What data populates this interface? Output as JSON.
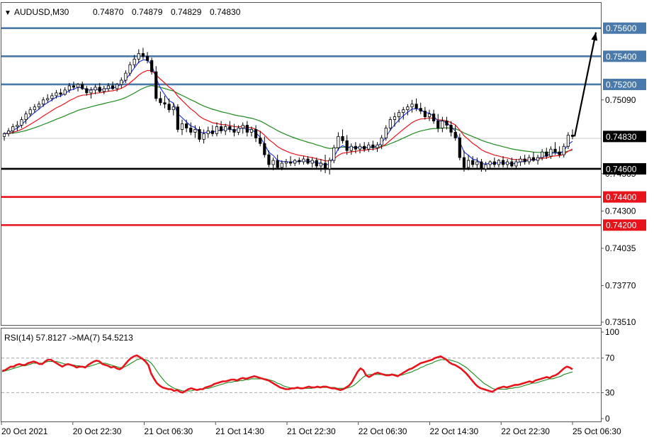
{
  "chart_data": [
    {
      "type": "candlestick",
      "symbol_line": "AUDUSD,M30",
      "ohlc_readout": [
        "0.74870",
        "0.74879",
        "0.74829",
        "0.74830"
      ],
      "ylim": [
        0.7349,
        0.7578
      ],
      "y_ticks": [
        "0.75090",
        "0.74565",
        "0.74300",
        "0.74035",
        "0.73770",
        "0.73510"
      ],
      "current_price": "0.74830",
      "levels": [
        {
          "value": 0.756,
          "label": "0.75600",
          "color": "#4a7aab"
        },
        {
          "value": 0.754,
          "label": "0.75400",
          "color": "#4a7aab"
        },
        {
          "value": 0.752,
          "label": "0.75200",
          "color": "#4a7aab"
        },
        {
          "value": 0.746,
          "label": "0.74600",
          "color": "#000000"
        },
        {
          "value": 0.744,
          "label": "0.74400",
          "color": "#e8141c"
        },
        {
          "value": 0.742,
          "label": "0.74200",
          "color": "#e8141c"
        }
      ],
      "arrow": {
        "from": 0.7483,
        "to": 0.7557
      },
      "ma_colors": {
        "fast": "#2a3bd6",
        "mid": "#e8141c",
        "slow": "#1e8a1e"
      },
      "candles": [
        [
          0.7483,
          0.7486,
          0.748,
          0.7485
        ],
        [
          0.7485,
          0.7489,
          0.7483,
          0.7487
        ],
        [
          0.7487,
          0.7492,
          0.7485,
          0.749
        ],
        [
          0.749,
          0.7494,
          0.7487,
          0.7491
        ],
        [
          0.7491,
          0.7497,
          0.7489,
          0.7495
        ],
        [
          0.7495,
          0.7501,
          0.7492,
          0.7499
        ],
        [
          0.7499,
          0.7504,
          0.7497,
          0.7502
        ],
        [
          0.7502,
          0.7506,
          0.75,
          0.7504
        ],
        [
          0.7504,
          0.7508,
          0.7502,
          0.7506
        ],
        [
          0.7506,
          0.7511,
          0.7504,
          0.7509
        ],
        [
          0.7509,
          0.7513,
          0.7507,
          0.751
        ],
        [
          0.751,
          0.7514,
          0.7508,
          0.7512
        ],
        [
          0.7512,
          0.7516,
          0.751,
          0.7514
        ],
        [
          0.7514,
          0.7517,
          0.7511,
          0.7513
        ],
        [
          0.7513,
          0.7518,
          0.7512,
          0.7516
        ],
        [
          0.7516,
          0.7521,
          0.7514,
          0.7519
        ],
        [
          0.7519,
          0.7522,
          0.7516,
          0.7518
        ],
        [
          0.7518,
          0.7521,
          0.7515,
          0.752
        ],
        [
          0.752,
          0.7522,
          0.7516,
          0.7517
        ],
        [
          0.7517,
          0.7519,
          0.7512,
          0.7514
        ],
        [
          0.7514,
          0.7518,
          0.751,
          0.7516
        ],
        [
          0.7516,
          0.752,
          0.7513,
          0.7518
        ],
        [
          0.7518,
          0.7521,
          0.7514,
          0.7515
        ],
        [
          0.7515,
          0.7519,
          0.7513,
          0.7517
        ],
        [
          0.7517,
          0.7521,
          0.7515,
          0.7519
        ],
        [
          0.7519,
          0.7522,
          0.7516,
          0.7517
        ],
        [
          0.7517,
          0.7521,
          0.7515,
          0.752
        ],
        [
          0.752,
          0.7525,
          0.7517,
          0.7523
        ],
        [
          0.7523,
          0.753,
          0.7521,
          0.7528
        ],
        [
          0.7528,
          0.7536,
          0.7526,
          0.7534
        ],
        [
          0.7534,
          0.7541,
          0.7532,
          0.7538
        ],
        [
          0.7538,
          0.7545,
          0.7535,
          0.7542
        ],
        [
          0.7542,
          0.7546,
          0.7538,
          0.754
        ],
        [
          0.754,
          0.7543,
          0.7535,
          0.7537
        ],
        [
          0.7537,
          0.7539,
          0.7527,
          0.7529
        ],
        [
          0.7529,
          0.7533,
          0.7508,
          0.751
        ],
        [
          0.751,
          0.7515,
          0.7505,
          0.7507
        ],
        [
          0.7507,
          0.7512,
          0.7503,
          0.7506
        ],
        [
          0.7506,
          0.751,
          0.75,
          0.7502
        ],
        [
          0.7502,
          0.7507,
          0.7498,
          0.7504
        ],
        [
          0.7504,
          0.7506,
          0.7486,
          0.7488
        ],
        [
          0.7488,
          0.7495,
          0.7484,
          0.7492
        ],
        [
          0.7492,
          0.7495,
          0.7486,
          0.7489
        ],
        [
          0.7489,
          0.7493,
          0.7484,
          0.7486
        ],
        [
          0.7486,
          0.7491,
          0.7482,
          0.7488
        ],
        [
          0.7488,
          0.749,
          0.7479,
          0.7481
        ],
        [
          0.7481,
          0.7488,
          0.7478,
          0.7485
        ],
        [
          0.7485,
          0.749,
          0.7482,
          0.7487
        ],
        [
          0.7487,
          0.7491,
          0.7483,
          0.7485
        ],
        [
          0.7485,
          0.7493,
          0.7483,
          0.749
        ],
        [
          0.749,
          0.7494,
          0.7485,
          0.7487
        ],
        [
          0.7487,
          0.7492,
          0.7484,
          0.749
        ],
        [
          0.749,
          0.7494,
          0.7486,
          0.7488
        ],
        [
          0.7488,
          0.7492,
          0.7483,
          0.7486
        ],
        [
          0.7486,
          0.7491,
          0.7484,
          0.7489
        ],
        [
          0.7489,
          0.7493,
          0.7485,
          0.7491
        ],
        [
          0.7491,
          0.7494,
          0.7483,
          0.7486
        ],
        [
          0.7486,
          0.749,
          0.7483,
          0.7488
        ],
        [
          0.7488,
          0.7491,
          0.7479,
          0.7482
        ],
        [
          0.7482,
          0.7487,
          0.7476,
          0.7478
        ],
        [
          0.7478,
          0.7483,
          0.7468,
          0.747
        ],
        [
          0.747,
          0.7473,
          0.7461,
          0.7463
        ],
        [
          0.7463,
          0.7468,
          0.7459,
          0.7466
        ],
        [
          0.7466,
          0.747,
          0.746,
          0.7461
        ],
        [
          0.7461,
          0.7466,
          0.7459,
          0.7464
        ],
        [
          0.7464,
          0.7467,
          0.7461,
          0.7465
        ],
        [
          0.7465,
          0.7469,
          0.7462,
          0.7464
        ],
        [
          0.7464,
          0.7467,
          0.7462,
          0.7466
        ],
        [
          0.7466,
          0.7468,
          0.7463,
          0.7465
        ],
        [
          0.7465,
          0.7469,
          0.7463,
          0.7467
        ],
        [
          0.7467,
          0.7469,
          0.7463,
          0.7464
        ],
        [
          0.7464,
          0.7468,
          0.7461,
          0.7466
        ],
        [
          0.7466,
          0.7468,
          0.746,
          0.7462
        ],
        [
          0.7462,
          0.7467,
          0.7458,
          0.7464
        ],
        [
          0.7464,
          0.747,
          0.7457,
          0.746
        ],
        [
          0.746,
          0.7468,
          0.7456,
          0.7466
        ],
        [
          0.7466,
          0.7477,
          0.7464,
          0.7475
        ],
        [
          0.7475,
          0.7486,
          0.7473,
          0.7483
        ],
        [
          0.7483,
          0.7488,
          0.7478,
          0.748
        ],
        [
          0.748,
          0.7484,
          0.747,
          0.7473
        ],
        [
          0.7473,
          0.7478,
          0.747,
          0.7476
        ],
        [
          0.7476,
          0.7479,
          0.7471,
          0.7474
        ],
        [
          0.7474,
          0.7478,
          0.7471,
          0.7476
        ],
        [
          0.7476,
          0.7479,
          0.7472,
          0.7474
        ],
        [
          0.7474,
          0.7479,
          0.7472,
          0.7477
        ],
        [
          0.7477,
          0.748,
          0.7473,
          0.7475
        ],
        [
          0.7475,
          0.7479,
          0.7472,
          0.7477
        ],
        [
          0.7477,
          0.7484,
          0.7474,
          0.7482
        ],
        [
          0.7482,
          0.7491,
          0.748,
          0.7489
        ],
        [
          0.7489,
          0.7497,
          0.7487,
          0.7495
        ],
        [
          0.7495,
          0.75,
          0.749,
          0.7497
        ],
        [
          0.7497,
          0.7502,
          0.7493,
          0.75
        ],
        [
          0.75,
          0.7504,
          0.7495,
          0.7502
        ],
        [
          0.7502,
          0.7506,
          0.7498,
          0.7504
        ],
        [
          0.7504,
          0.7509,
          0.75,
          0.7506
        ],
        [
          0.7506,
          0.751,
          0.7501,
          0.7503
        ],
        [
          0.7503,
          0.7507,
          0.7499,
          0.7501
        ],
        [
          0.7501,
          0.7504,
          0.7495,
          0.7497
        ],
        [
          0.7497,
          0.7502,
          0.7494,
          0.7499
        ],
        [
          0.7499,
          0.7502,
          0.7492,
          0.7494
        ],
        [
          0.7494,
          0.7499,
          0.7486,
          0.7489
        ],
        [
          0.7489,
          0.7497,
          0.7486,
          0.7494
        ],
        [
          0.7494,
          0.7497,
          0.7488,
          0.7491
        ],
        [
          0.7491,
          0.7494,
          0.7483,
          0.7486
        ],
        [
          0.7486,
          0.7491,
          0.748,
          0.7482
        ],
        [
          0.7482,
          0.7485,
          0.7466,
          0.7468
        ],
        [
          0.7468,
          0.7473,
          0.7458,
          0.7461
        ],
        [
          0.7461,
          0.747,
          0.7459,
          0.7466
        ],
        [
          0.7466,
          0.7469,
          0.7461,
          0.7463
        ],
        [
          0.7463,
          0.7468,
          0.746,
          0.7465
        ],
        [
          0.7465,
          0.7467,
          0.7458,
          0.746
        ],
        [
          0.746,
          0.7465,
          0.7458,
          0.7463
        ],
        [
          0.7463,
          0.7466,
          0.746,
          0.7465
        ],
        [
          0.7465,
          0.7468,
          0.7461,
          0.7463
        ],
        [
          0.7463,
          0.7467,
          0.7461,
          0.7466
        ],
        [
          0.7466,
          0.7469,
          0.7461,
          0.7463
        ],
        [
          0.7463,
          0.7467,
          0.746,
          0.7465
        ],
        [
          0.7465,
          0.7468,
          0.7461,
          0.7462
        ],
        [
          0.7462,
          0.7467,
          0.746,
          0.7465
        ],
        [
          0.7465,
          0.7469,
          0.7462,
          0.7467
        ],
        [
          0.7467,
          0.747,
          0.7463,
          0.7465
        ],
        [
          0.7465,
          0.747,
          0.7463,
          0.7468
        ],
        [
          0.7468,
          0.7472,
          0.7465,
          0.7466
        ],
        [
          0.7466,
          0.747,
          0.7463,
          0.7468
        ],
        [
          0.7468,
          0.7474,
          0.7466,
          0.7472
        ],
        [
          0.7472,
          0.7475,
          0.7467,
          0.7469
        ],
        [
          0.7469,
          0.7476,
          0.7467,
          0.7474
        ],
        [
          0.7474,
          0.7479,
          0.747,
          0.7472
        ],
        [
          0.7472,
          0.7476,
          0.7468,
          0.747
        ],
        [
          0.747,
          0.7478,
          0.7468,
          0.7476
        ],
        [
          0.7476,
          0.7486,
          0.7474,
          0.7484
        ],
        [
          0.7484,
          0.7488,
          0.7481,
          0.7483
        ]
      ],
      "rsi": {
        "label": "RSI(14) 57.8127  ->MA(7) 54.5213",
        "ylim": [
          0,
          100
        ],
        "ticks": [
          "100",
          "70",
          "30",
          "0"
        ],
        "levels": [
          70,
          30
        ],
        "values": [
          55,
          56,
          58,
          60,
          60,
          62,
          63,
          62,
          62,
          64,
          65,
          66,
          65,
          63,
          63,
          66,
          68,
          68,
          66,
          64,
          62,
          60,
          62,
          63,
          62,
          61,
          59,
          60,
          60,
          59,
          62,
          64,
          66,
          67,
          66,
          63,
          62,
          61,
          59,
          60,
          58,
          57,
          59,
          63,
          67,
          70,
          72,
          73,
          71,
          69,
          66,
          62,
          52,
          46,
          41,
          38,
          36,
          35,
          34,
          34,
          32,
          33,
          31,
          30,
          32,
          34,
          35,
          34,
          33,
          34,
          34,
          36,
          37,
          38,
          40,
          41,
          42,
          43,
          43,
          44,
          45,
          45,
          44,
          46,
          47,
          46,
          47,
          48,
          49,
          48,
          47,
          46,
          45,
          44,
          42,
          40,
          38,
          36,
          35,
          34,
          34,
          35,
          35,
          36,
          35,
          35,
          36,
          37,
          36,
          36,
          37,
          36,
          37,
          37,
          36,
          35,
          35,
          34,
          33,
          34,
          36,
          38,
          42,
          48,
          54,
          58,
          56,
          50,
          48,
          50,
          52,
          53,
          52,
          51,
          50,
          50,
          51,
          50,
          49,
          51,
          53,
          55,
          57,
          58,
          60,
          62,
          64,
          65,
          66,
          67,
          68,
          70,
          71,
          72,
          70,
          68,
          65,
          63,
          62,
          60,
          58,
          55,
          52,
          48,
          44,
          40,
          37,
          35,
          34,
          33,
          32,
          31,
          33,
          35,
          36,
          37,
          36,
          37,
          38,
          39,
          39,
          40,
          41,
          42,
          43,
          42,
          44,
          45,
          46,
          47,
          48,
          47,
          49,
          50,
          52,
          55,
          58,
          60,
          59,
          57
        ],
        "ma": [
          54,
          55,
          56,
          57,
          58,
          59,
          60,
          61,
          61,
          62,
          63,
          64,
          64,
          64,
          64,
          65,
          66,
          66,
          66,
          66,
          65,
          64,
          63,
          63,
          62,
          62,
          61,
          61,
          60,
          60,
          60,
          61,
          62,
          63,
          64,
          64,
          64,
          63,
          62,
          61,
          60,
          59,
          59,
          60,
          62,
          64,
          66,
          68,
          69,
          69,
          68,
          67,
          64,
          60,
          55,
          50,
          46,
          42,
          39,
          37,
          35,
          34,
          33,
          32,
          32,
          32,
          32,
          33,
          33,
          34,
          34,
          35,
          35,
          36,
          37,
          38,
          39,
          40,
          41,
          42,
          42,
          43,
          43,
          44,
          44,
          45,
          45,
          46,
          46,
          46,
          46,
          46,
          46,
          45,
          44,
          43,
          41,
          40,
          38,
          37,
          36,
          35,
          35,
          35,
          35,
          35,
          35,
          35,
          35,
          36,
          36,
          36,
          36,
          36,
          36,
          36,
          36,
          35,
          35,
          35,
          35,
          36,
          37,
          39,
          42,
          45,
          48,
          50,
          51,
          51,
          51,
          51,
          51,
          51,
          51,
          51,
          51,
          51,
          50,
          50,
          51,
          52,
          53,
          54,
          56,
          57,
          59,
          60,
          62,
          63,
          64,
          66,
          67,
          68,
          68,
          68,
          68,
          67,
          66,
          65,
          63,
          61,
          59,
          56,
          53,
          50,
          47,
          44,
          41,
          39,
          37,
          35,
          34,
          34,
          34,
          34,
          34,
          35,
          35,
          36,
          36,
          37,
          38,
          39,
          40,
          41,
          41,
          42,
          43,
          44,
          45,
          46,
          46,
          47,
          48,
          49,
          51,
          52,
          53,
          54
        ]
      },
      "x_ticks": [
        "20 Oct 2021",
        "20 Oct 22:30",
        "21 Oct 06:30",
        "21 Oct 14:30",
        "21 Oct 22:30",
        "22 Oct 06:30",
        "22 Oct 14:30",
        "22 Oct 22:30",
        "25 Oct 06:30"
      ]
    }
  ]
}
